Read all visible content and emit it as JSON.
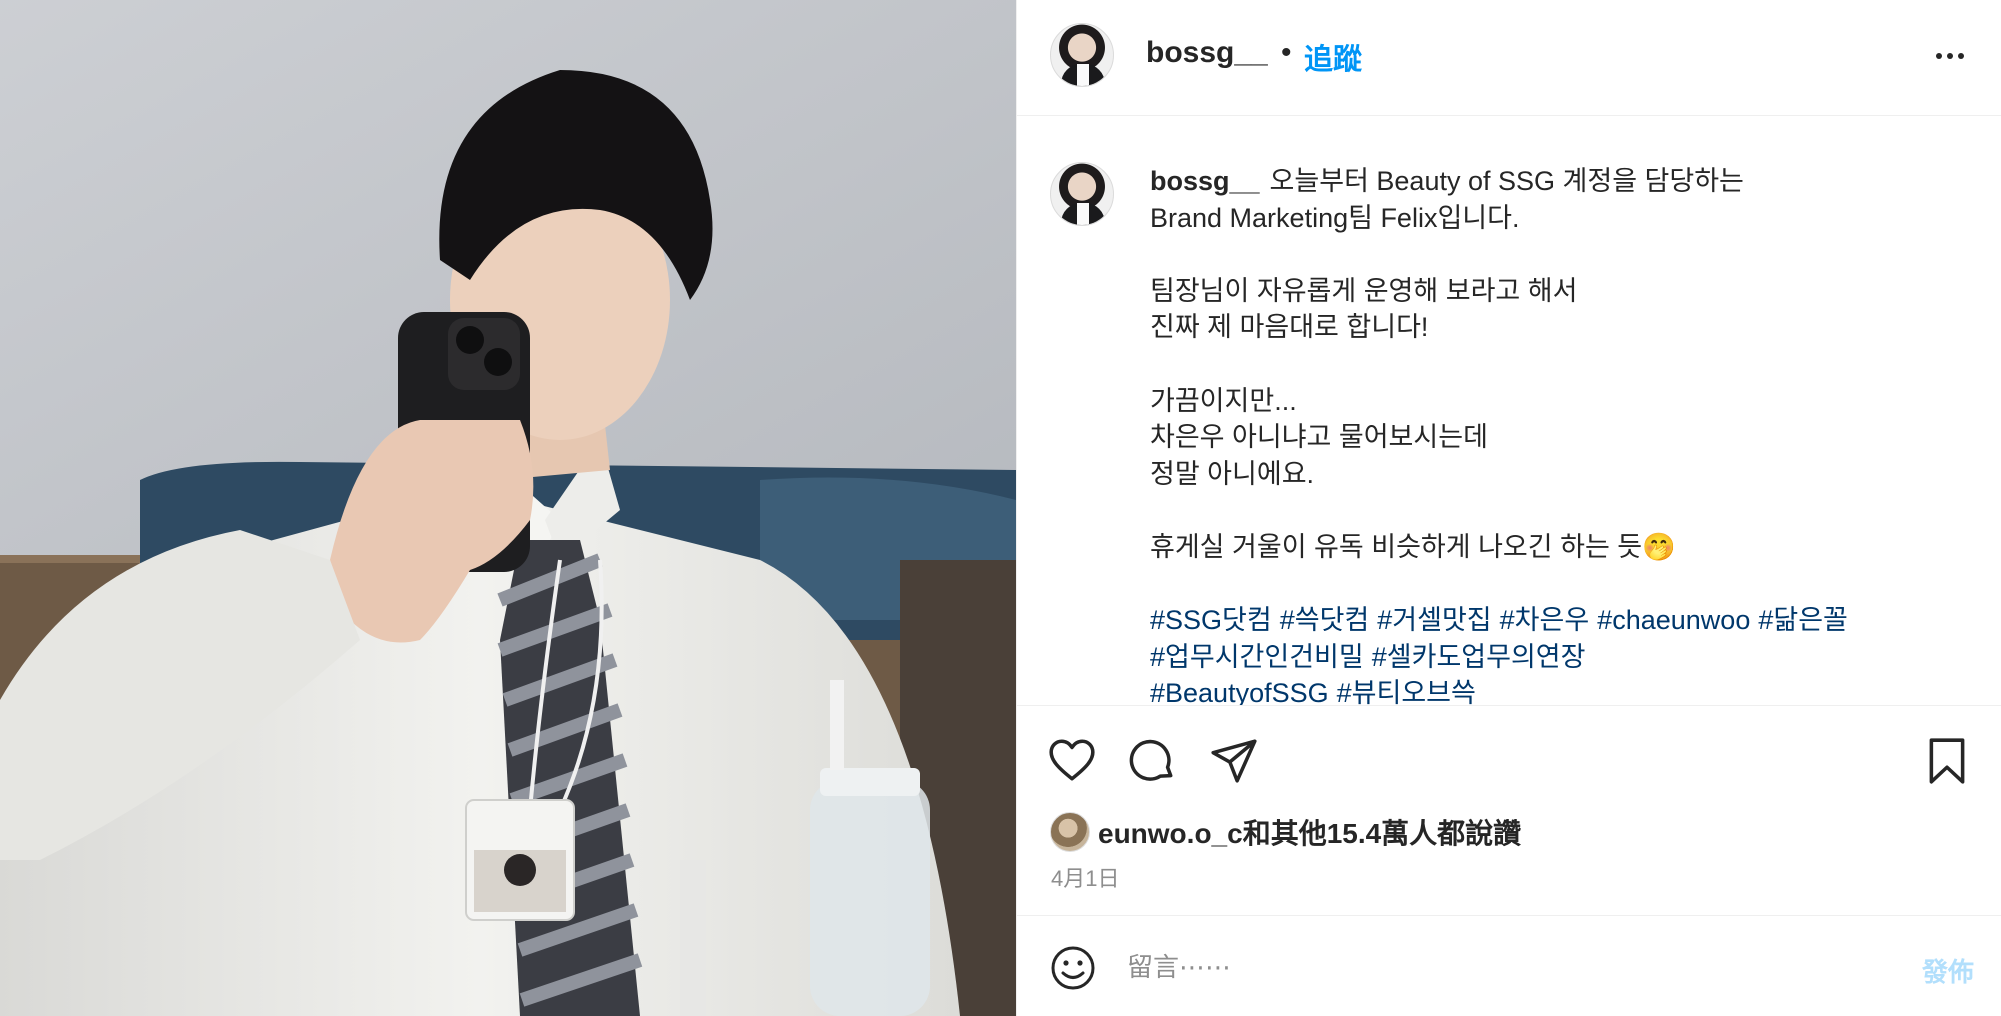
{
  "post": {
    "username": "bossg__",
    "separator": "•",
    "follow_label": "追蹤",
    "caption_username": "bossg__",
    "caption_lines": [
      "오늘부터 Beauty of SSG 계정을 담당하는",
      "Brand Marketing팀 Felix입니다.",
      "",
      "팀장님이 자유롭게 운영해 보라고 해서",
      "진짜 제 마음대로 합니다!",
      "",
      "가끔이지만...",
      "차은우 아니냐고 물어보시는데",
      "정말 아니에요.",
      "",
      "휴게실 거울이 유독 비슷하게 나오긴 하는 듯🤭"
    ],
    "hashtags": [
      [
        "#SSG닷컴",
        "#쓱닷컴",
        "#거셀맛집",
        "#차은우",
        "#chaeunwoo",
        "#닮은꼴"
      ],
      [
        "#업무시간인건비밀",
        "#셀카도업무의연장"
      ],
      [
        "#BeautyofSSG",
        "#뷰티오브쓱"
      ]
    ],
    "likes_text": "eunwo.o_c和其他15.4萬人都說讚",
    "date": "4月1日"
  },
  "comment_box": {
    "placeholder": "留言⋯⋯",
    "post_label": "發佈"
  },
  "icons": {
    "like": "heart-icon",
    "comment": "comment-bubble-icon",
    "share": "paper-plane-icon",
    "save": "bookmark-icon",
    "emoji": "smiley-icon",
    "more": "more-options-icon"
  },
  "colors": {
    "link_blue": "#0095f6",
    "hashtag": "#00376b",
    "text": "#262626",
    "muted": "#8e8e8e",
    "post_disabled": "#b2dffc"
  }
}
